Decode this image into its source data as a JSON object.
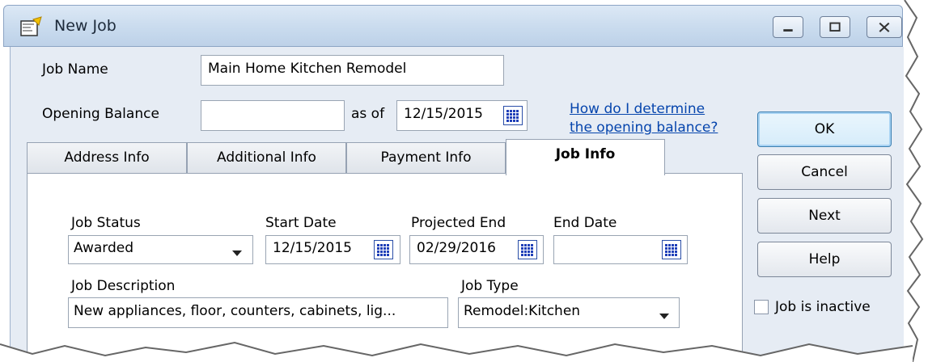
{
  "window": {
    "title": "New Job",
    "icon": "new-job-icon",
    "controls": [
      "minimize-icon",
      "maximize-icon",
      "close-icon"
    ]
  },
  "job_name": {
    "label": "Job Name",
    "value": "Main Home Kitchen Remodel"
  },
  "opening_balance": {
    "label": "Opening Balance",
    "value": "",
    "as_of_label": "as of",
    "as_of_date": "12/15/2015",
    "help_link_line1": "How do I determine",
    "help_link_line2": "the opening balance?"
  },
  "buttons": {
    "ok": "OK",
    "cancel": "Cancel",
    "next": "Next",
    "help": "Help"
  },
  "inactive": {
    "label": "Job is inactive",
    "checked": false
  },
  "tabs": [
    {
      "label": "Address Info",
      "active": false
    },
    {
      "label": "Additional Info",
      "active": false
    },
    {
      "label": "Payment Info",
      "active": false
    },
    {
      "label": "Job Info",
      "active": true
    }
  ],
  "job_info": {
    "status_label": "Job Status",
    "status_value": "Awarded",
    "start_label": "Start Date",
    "start_value": "12/15/2015",
    "projected_label": "Projected End",
    "projected_value": "02/29/2016",
    "end_label": "End Date",
    "end_value": "",
    "description_label": "Job Description",
    "description_value": "New appliances, floor, counters, cabinets, lig...",
    "type_label": "Job Type",
    "type_value": "Remodel:Kitchen"
  },
  "colors": {
    "link": "#0645ad",
    "accent": "#3c7fb1",
    "calendar": "#1f3fb8"
  }
}
